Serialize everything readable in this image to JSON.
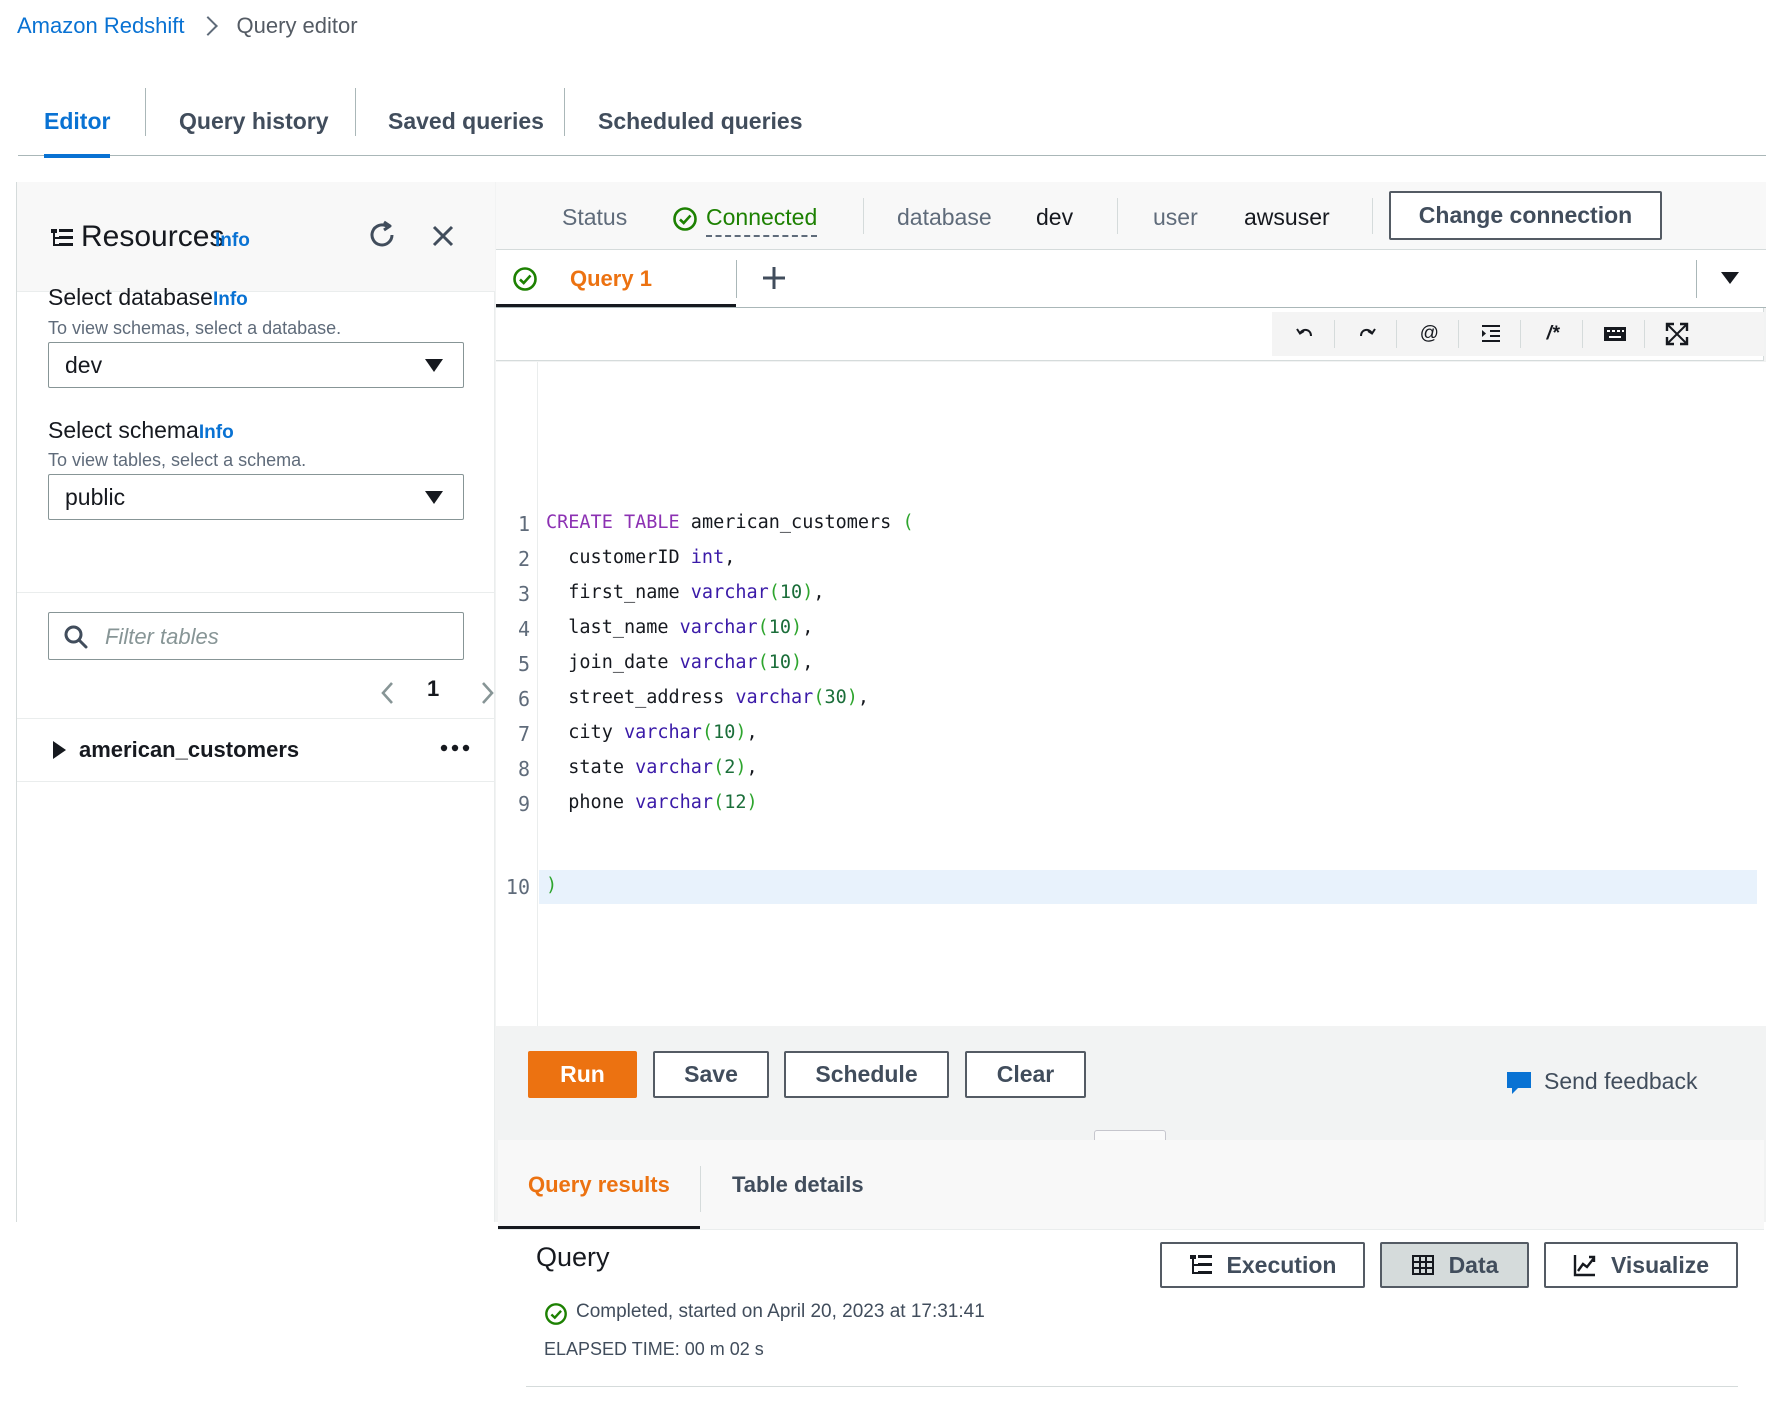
{
  "breadcrumb": {
    "service": "Amazon Redshift",
    "current": "Query editor"
  },
  "top_tabs": [
    {
      "label": "Editor",
      "active": true
    },
    {
      "label": "Query history",
      "active": false
    },
    {
      "label": "Saved queries",
      "active": false
    },
    {
      "label": "Scheduled queries",
      "active": false
    }
  ],
  "resources": {
    "title": "Resources",
    "info": "Info",
    "database": {
      "label": "Select database",
      "info": "Info",
      "hint": "To view schemas, select a database.",
      "value": "dev"
    },
    "schema": {
      "label": "Select schema",
      "info": "Info",
      "hint": "To view tables, select a schema.",
      "value": "public"
    },
    "filter_placeholder": "Filter tables",
    "page": "1",
    "tables": [
      {
        "name": "american_customers"
      }
    ]
  },
  "connection": {
    "status_label": "Status",
    "status_value": "Connected",
    "database_label": "database",
    "database_value": "dev",
    "user_label": "user",
    "user_value": "awsuser",
    "change_button": "Change connection"
  },
  "query_tab": {
    "label": "Query 1"
  },
  "toolbar_icons": [
    "undo-icon",
    "redo-icon",
    "at-sign-icon",
    "indent-icon",
    "comment-icon",
    "keyboard-icon",
    "fullscreen-icon"
  ],
  "toolbar_glyphs": {
    "at": "@",
    "comment": "/*"
  },
  "code": {
    "line_numbers": [
      "1",
      "2",
      "3",
      "4",
      "5",
      "6",
      "7",
      "8",
      "9",
      "10"
    ],
    "lines": [
      "CREATE TABLE american_customers (",
      "  customerID int,",
      "  first_name varchar(10),",
      "  last_name varchar(10),",
      "  join_date varchar(10),",
      "  street_address varchar(30),",
      "  city varchar(10),",
      "  state varchar(2),",
      "  phone varchar(12)",
      ")"
    ],
    "active_line": 10
  },
  "actions": {
    "run": "Run",
    "save": "Save",
    "schedule": "Schedule",
    "clear": "Clear",
    "feedback": "Send feedback"
  },
  "result_tabs": [
    {
      "label": "Query results",
      "active": true
    },
    {
      "label": "Table details",
      "active": false
    }
  ],
  "results": {
    "title": "Query",
    "execution_button": "Execution",
    "data_button": "Data",
    "visualize_button": "Visualize",
    "status_text": "Completed, started on April 20, 2023 at 17:31:41",
    "elapsed_text": "ELAPSED TIME: 00 m 02 s"
  },
  "colors": {
    "link_blue": "#0972d3",
    "accent_orange": "#ec7211",
    "success_green": "#1d8102",
    "keyword_purple": "#8c31b3",
    "type_indigo": "#3a1aa8",
    "number_green": "#1b6e3a"
  }
}
